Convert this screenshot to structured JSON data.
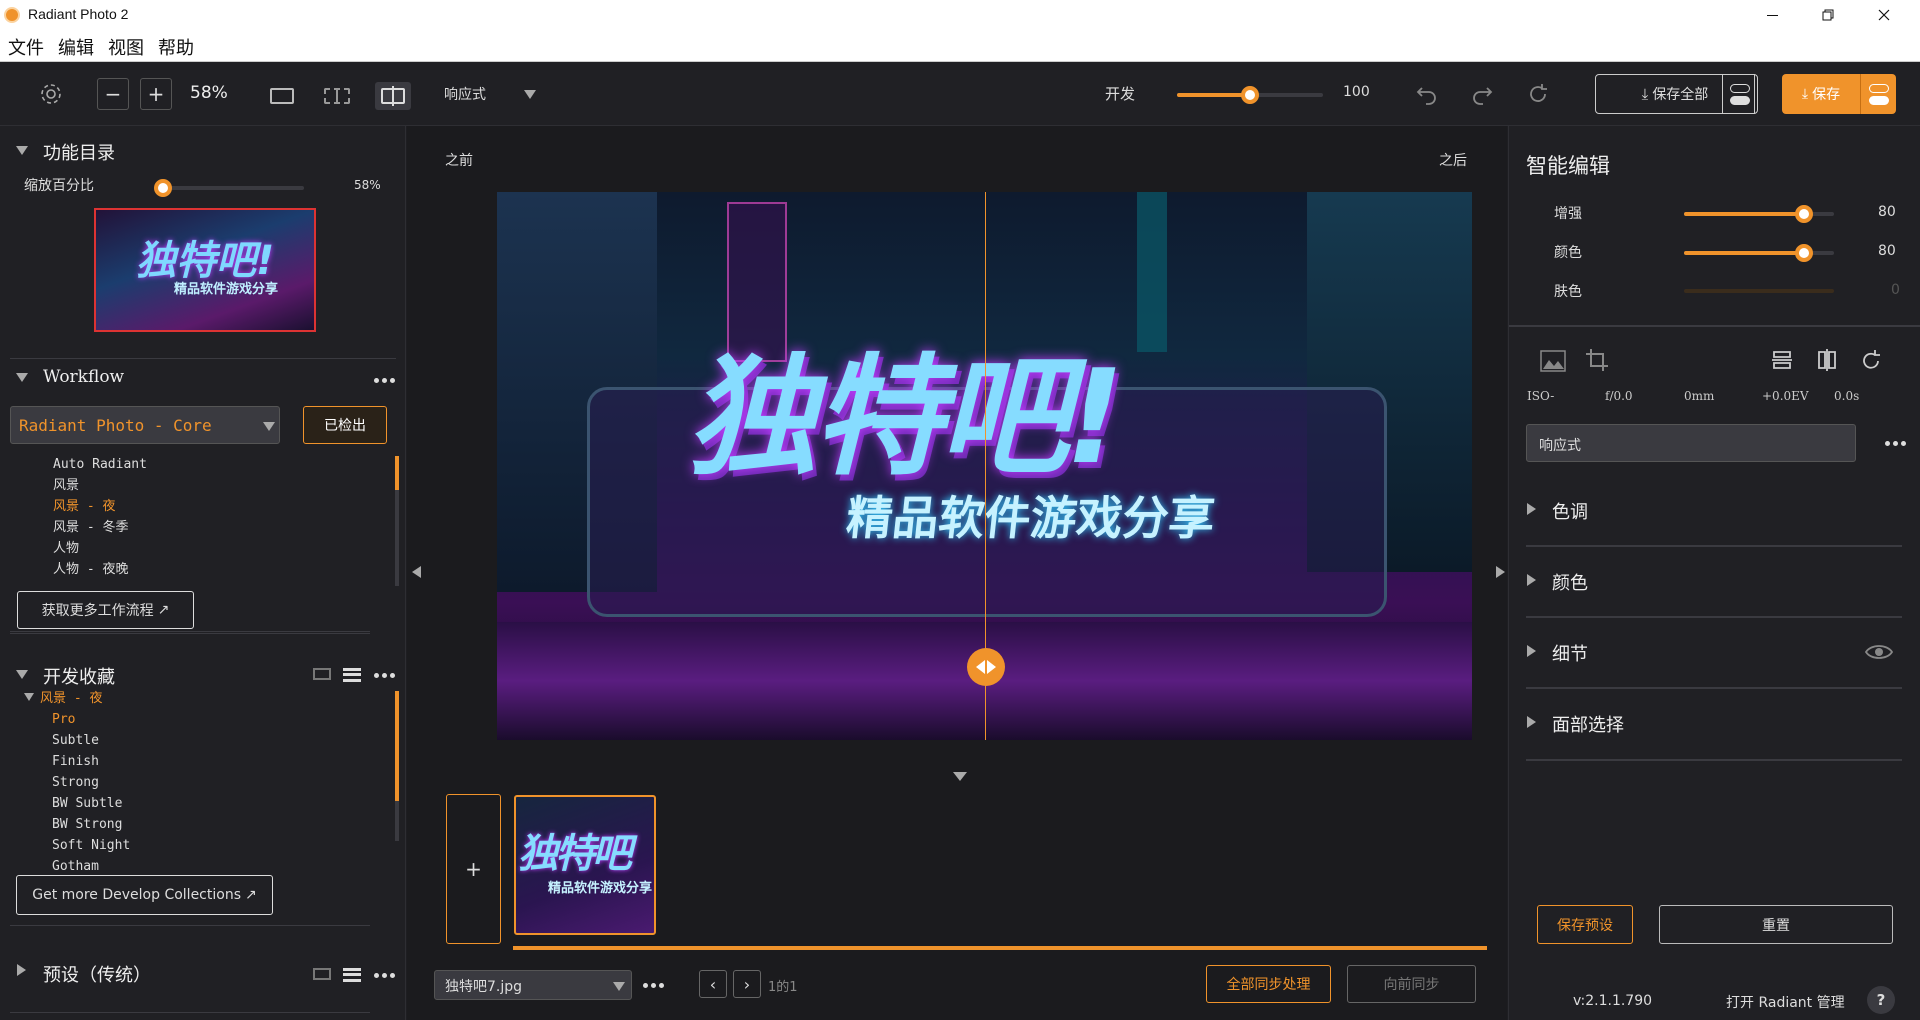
{
  "app": {
    "title": "Radiant Photo 2"
  },
  "menu": [
    "文件",
    "编辑",
    "视图",
    "帮助"
  ],
  "toolbar": {
    "zoom": "58%",
    "view_mode": "响应式",
    "develop_label": "开发",
    "develop_value": "100",
    "develop_level": 0.5,
    "save_all_label": "保存全部",
    "save_label": "保存",
    "accent": "#f0932b"
  },
  "left": {
    "catalog_title": "功能目录",
    "zoom_label": "缩放百分比",
    "zoom_value": "58%",
    "zoom_level": 0.02,
    "thumb_title": "独特吧!",
    "thumb_subtitle": "精品软件游戏分享",
    "workflow_title": "Workflow",
    "workflow_selected": "Radiant Photo - Core",
    "checkout_label": "已检出",
    "workflow_items": [
      "Auto Radiant",
      "风景",
      "风景 - 夜",
      "风景 - 冬季",
      "人物",
      "人物 - 夜晚"
    ],
    "get_more_workflows": "获取更多工作流程",
    "collections_title": "开发收藏",
    "collection_group": "风景 - 夜",
    "collection_items": [
      "Pro",
      "Subtle",
      "Finish",
      "Strong",
      "BW Subtle",
      "BW Strong",
      "Soft Night",
      "Gotham"
    ],
    "get_more_collections": "Get more Develop Collections",
    "presets_title": "预设（传统）"
  },
  "center": {
    "before_label": "之前",
    "after_label": "之后",
    "image_title": "独特吧!",
    "image_subtitle": "精品软件游戏分享",
    "add_label": "+",
    "filmstrip_title": "独特吧",
    "filmstrip_subtitle": "精品软件游戏分享",
    "file_name": "独特吧7.jpg",
    "page_info": "1的1",
    "sync_all_label": "全部同步处理",
    "sync_prev_label": "向前同步"
  },
  "right": {
    "smart_title": "智能编辑",
    "sliders": [
      {
        "label": "增强",
        "value": "80",
        "level": 0.8
      },
      {
        "label": "颜色",
        "value": "80",
        "level": 0.8
      },
      {
        "label": "肤色",
        "value": "0",
        "level": 0
      }
    ],
    "meta": [
      "ISO-",
      "f/0.0",
      "0mm",
      "+0.0EV",
      "0.0s"
    ],
    "mode": "响应式",
    "sections": [
      "色调",
      "颜色",
      "细节",
      "面部选择"
    ],
    "save_preset_label": "保存预设",
    "reset_label": "重置",
    "version": "v:2.1.1.790",
    "open_manager": "打开 Radiant 管理",
    "help": "?"
  }
}
